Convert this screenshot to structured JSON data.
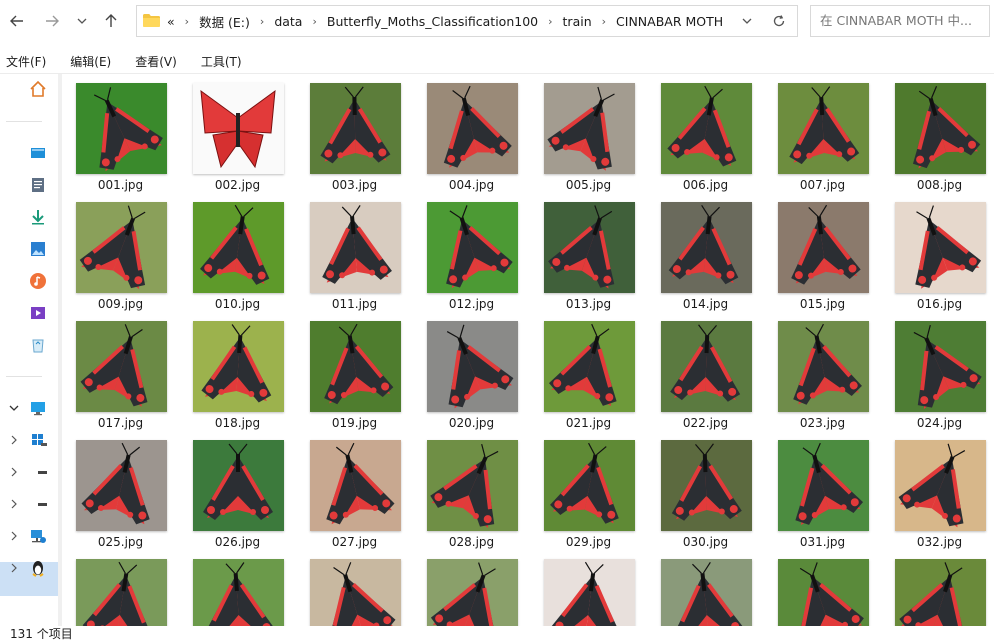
{
  "nav": {
    "back_icon": "arrow-left-icon",
    "forward_icon": "arrow-right-icon",
    "recent_icon": "chevron-down-icon",
    "up_icon": "arrow-up-icon"
  },
  "address": {
    "overflow": "«",
    "crumbs": [
      "数据 (E:)",
      "data",
      "Butterfly_Moths_Classification100",
      "train",
      "CINNABAR MOTH"
    ]
  },
  "search": {
    "placeholder": "在 CINNABAR MOTH 中..."
  },
  "menu": [
    "文件(F)",
    "编辑(E)",
    "查看(V)",
    "工具(T)"
  ],
  "sidebar": {
    "items": [
      "home-icon",
      "desktop-icon",
      "documents-icon",
      "downloads-icon",
      "pictures-icon",
      "music-icon",
      "videos-icon",
      "recycle-bin-icon"
    ],
    "tree": [
      "this-pc-icon",
      "windows-drive-icon",
      "drive-icon",
      "drive-icon",
      "network-icon",
      "linux-icon"
    ]
  },
  "files": [
    "001.jpg",
    "002.jpg",
    "003.jpg",
    "004.jpg",
    "005.jpg",
    "006.jpg",
    "007.jpg",
    "008.jpg",
    "009.jpg",
    "010.jpg",
    "011.jpg",
    "012.jpg",
    "013.jpg",
    "014.jpg",
    "015.jpg",
    "016.jpg",
    "017.jpg",
    "018.jpg",
    "019.jpg",
    "020.jpg",
    "021.jpg",
    "022.jpg",
    "023.jpg",
    "024.jpg",
    "025.jpg",
    "026.jpg",
    "027.jpg",
    "028.jpg",
    "029.jpg",
    "030.jpg",
    "031.jpg",
    "032.jpg",
    "",
    "",
    "",
    "",
    "",
    "",
    "",
    ""
  ],
  "backgrounds": [
    "#3a8a2c",
    "#fafafa",
    "#5c7d3a",
    "#9a8a78",
    "#a39c90",
    "#5f8a3a",
    "#6d8d3e",
    "#4f7a2d",
    "#8aa05a",
    "#5e9a2a",
    "#d8ccc0",
    "#4c9a34",
    "#40603a",
    "#6a6a5c",
    "#8b7a6c",
    "#e6d8cc",
    "#6b8a45",
    "#9cb24d",
    "#4f7d2e",
    "#8a8a88",
    "#6e9a3a",
    "#5b7a40",
    "#6f8c4a",
    "#4e7d34",
    "#9c958f",
    "#3c7a3c",
    "#c8a890",
    "#6f8f45",
    "#5f8a35",
    "#5c6a3f",
    "#4c8c40",
    "#d7b78a",
    "#7a9a5a",
    "#6b9a4a",
    "#c8b8a0",
    "#8aa06a",
    "#e8e0dc",
    "#8a9a7a",
    "#5a8a3a",
    "#6a8a3a"
  ],
  "status": {
    "count": "131 个项目"
  },
  "colors": {
    "moth_red": "#e23a3a",
    "moth_dark": "#2b2e33",
    "selection": "#cce0f5"
  }
}
